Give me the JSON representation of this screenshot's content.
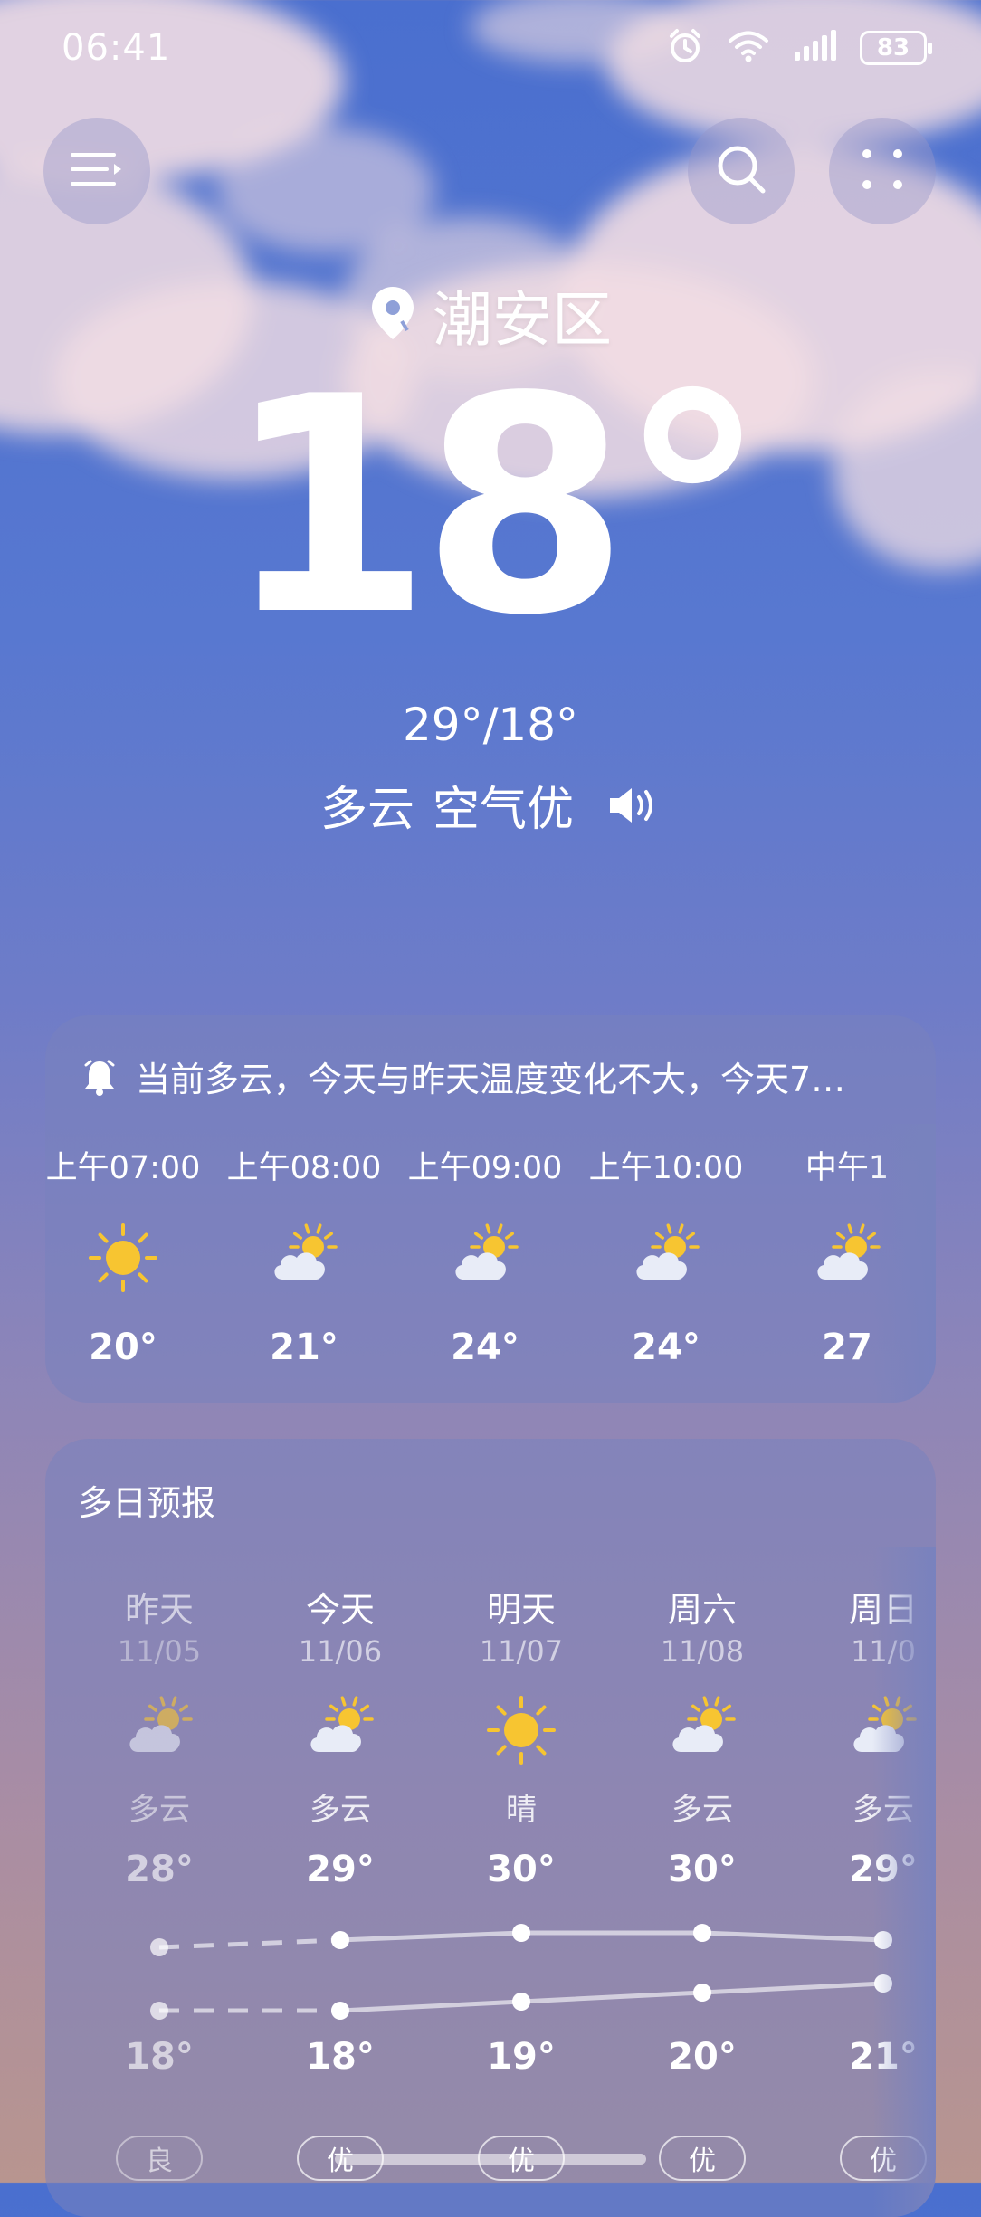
{
  "status_bar": {
    "time": "06:41",
    "battery": "83",
    "icons": [
      "alarm-icon",
      "wifi-icon",
      "signal-icon",
      "battery-icon"
    ]
  },
  "header": {
    "menu_icon": "menu-icon",
    "search_icon": "search-icon",
    "more_icon": "grid-dots-icon"
  },
  "current": {
    "location": "潮安区",
    "temperature": "18°",
    "high_low": "29°/18°",
    "condition": "多云",
    "air_quality": "空气优",
    "speaker_icon": "speaker-icon"
  },
  "hourly": {
    "alert_text": "当前多云，今天与昨天温度变化不大，今天7…",
    "items": [
      {
        "time": "上午07:00",
        "icon": "sunny",
        "temp": "20°"
      },
      {
        "time": "上午08:00",
        "icon": "partly-cloudy",
        "temp": "21°"
      },
      {
        "time": "上午09:00",
        "icon": "partly-cloudy",
        "temp": "24°"
      },
      {
        "time": "上午10:00",
        "icon": "partly-cloudy",
        "temp": "24°"
      },
      {
        "time": "中午1",
        "icon": "partly-cloudy",
        "temp": "27"
      }
    ]
  },
  "daily": {
    "title": "多日预报",
    "days": [
      {
        "name": "昨天",
        "date": "11/05",
        "icon": "partly-cloudy",
        "cond": "多云",
        "high": "28°",
        "low": "18°",
        "aqi": "良",
        "past": true
      },
      {
        "name": "今天",
        "date": "11/06",
        "icon": "partly-cloudy",
        "cond": "多云",
        "high": "29°",
        "low": "18°",
        "aqi": "优",
        "past": false
      },
      {
        "name": "明天",
        "date": "11/07",
        "icon": "sunny",
        "cond": "晴",
        "high": "30°",
        "low": "19°",
        "aqi": "优",
        "past": false
      },
      {
        "name": "周六",
        "date": "11/08",
        "icon": "partly-cloudy",
        "cond": "多云",
        "high": "30°",
        "low": "20°",
        "aqi": "优",
        "past": false
      },
      {
        "name": "周日",
        "date": "11/0",
        "icon": "partly-cloudy",
        "cond": "多云",
        "high": "29°",
        "low": "21°",
        "aqi": "优",
        "past": false
      }
    ],
    "high_values": [
      28,
      29,
      30,
      30,
      29
    ],
    "low_values": [
      18,
      18,
      19,
      20,
      21
    ]
  },
  "colors": {
    "sun": "#f7c531",
    "cloud": "#e8ecf7"
  }
}
